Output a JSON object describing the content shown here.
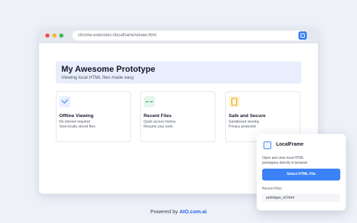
{
  "browser": {
    "address": "chrome-extension://localframe/viewer.html"
  },
  "hero": {
    "title": "My Awesome Prototype",
    "subtitle": "Viewing local HTML files made easy"
  },
  "cards": [
    {
      "icon": "checkmark-icon",
      "title": "Offline Viewing",
      "lines": [
        "No internet required",
        "View locally stored files"
      ]
    },
    {
      "icon": "history-icon",
      "title": "Recent Files",
      "lines": [
        "Quick access history",
        "Resume your work"
      ]
    },
    {
      "icon": "document-icon",
      "title": "Safe and Secure",
      "lines": [
        "Sandboxed viewing",
        "Privacy protected"
      ]
    }
  ],
  "popup": {
    "title": "LocalFrame",
    "description": "Open and view local HTML prototypes directly in browser",
    "select_button": "Select HTML File",
    "recent_label": "Recent Files",
    "recent_files": [
      "prototype_v2.html"
    ]
  },
  "footer": {
    "prefix": "Powered by",
    "brand": "AIO.com.ai"
  },
  "colors": {
    "accent": "#3b82f6",
    "page_background": "#eef1f8",
    "hero_background": "#e8eefb"
  }
}
